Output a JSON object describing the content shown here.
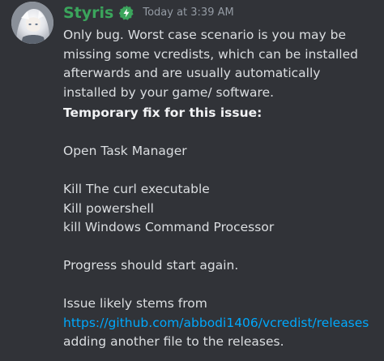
{
  "message": {
    "username": "Styris",
    "timestamp": "Today at 3:39 AM",
    "icons": {
      "avatar": "user-avatar",
      "badge": "bolt-badge-icon"
    },
    "colors": {
      "username": "#3ba55c",
      "badge": "#3ba55c",
      "link": "#00a8fc",
      "background": "#313338"
    },
    "paragraph_1": "Only bug. Worst case scenario is you may be missing some vcredists, which can be installed afterwards and are usually automatically installed by your game/ software.",
    "fix_heading": "Temporary fix for this issue:",
    "step_1": "Open Task Manager",
    "step_2": "Kill The curl executable",
    "step_3": "Kill powershell",
    "step_4": "kill Windows Command Processor",
    "progress_note": "Progress should start again.",
    "issue_intro": "Issue likely stems from",
    "issue_link": "https://github.com/abbodi1406/vcredist/releases",
    "issue_outro": "adding another file to the releases."
  }
}
